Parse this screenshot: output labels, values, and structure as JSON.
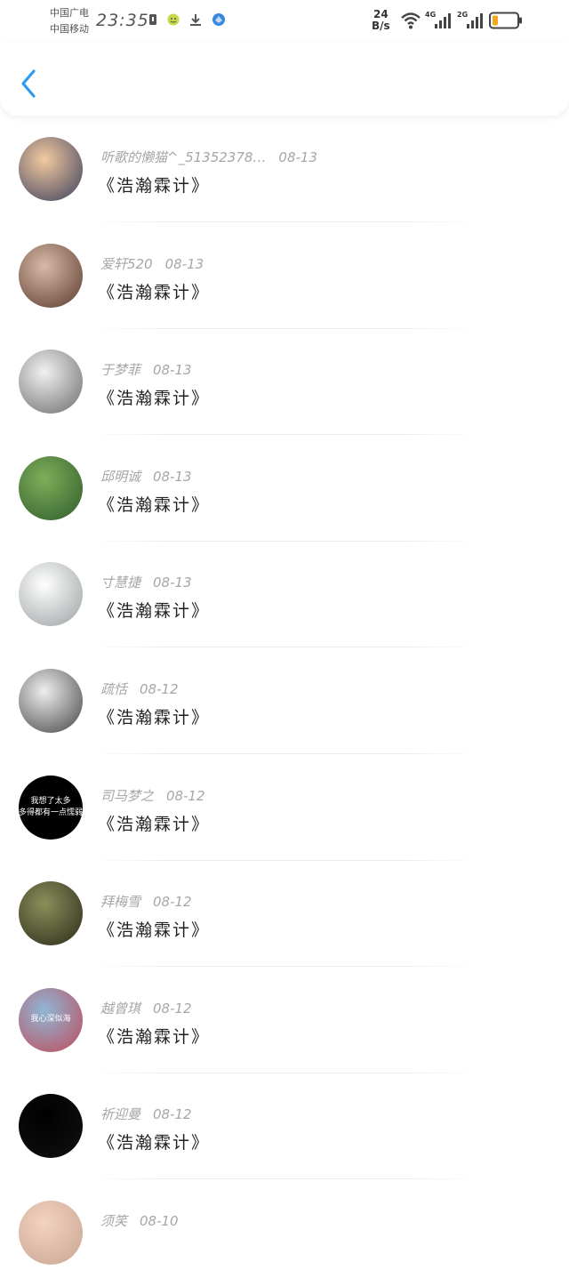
{
  "status_bar": {
    "carrier1": "中国广电",
    "carrier2": "中国移动",
    "time": "23:35",
    "net_speed_value": "24",
    "net_speed_unit": "B/s",
    "net1": "4G",
    "net2": "2G",
    "battery_color": "#f5a623"
  },
  "colors": {
    "accent": "#2a9af3",
    "meta_text": "#a6a6a6"
  },
  "list": [
    {
      "user": "听歌的懒猫^_51352378…",
      "date": "08-13",
      "title": "《浩瀚霖计》",
      "avatar_colors": [
        "#f3c9a0",
        "#3a3f5c"
      ]
    },
    {
      "user": "爱轩520",
      "date": "08-13",
      "title": "《浩瀚霖计》",
      "avatar_colors": [
        "#d9b9a8",
        "#5a3b2c"
      ]
    },
    {
      "user": "于梦菲",
      "date": "08-13",
      "title": "《浩瀚霖计》",
      "avatar_colors": [
        "#f1f1f1",
        "#6b6b6b"
      ]
    },
    {
      "user": "邱明诚",
      "date": "08-13",
      "title": "《浩瀚霖计》",
      "avatar_colors": [
        "#7fae5a",
        "#2f5c2a"
      ]
    },
    {
      "user": "寸慧捷",
      "date": "08-13",
      "title": "《浩瀚霖计》",
      "avatar_colors": [
        "#ffffff",
        "#9aa0a0"
      ]
    },
    {
      "user": "疏恬",
      "date": "08-12",
      "title": "《浩瀚霖计》",
      "avatar_colors": [
        "#eeeeee",
        "#444444"
      ]
    },
    {
      "user": "司马梦之",
      "date": "08-12",
      "title": "《浩瀚霖计》",
      "avatar_colors": [
        "#000000",
        "#000000"
      ],
      "avatar_text": "我想了太多\n多得都有一点懦弱"
    },
    {
      "user": "拜梅雪",
      "date": "08-12",
      "title": "《浩瀚霖计》",
      "avatar_colors": [
        "#8a8f5a",
        "#2c2a1a"
      ]
    },
    {
      "user": "越曾琪",
      "date": "08-12",
      "title": "《浩瀚霖计》",
      "avatar_colors": [
        "#8fb7d6",
        "#c04a5a"
      ],
      "avatar_text": "我心深似海"
    },
    {
      "user": "祈迎曼",
      "date": "08-12",
      "title": "《浩瀚霖计》",
      "avatar_colors": [
        "#000000",
        "#111111"
      ]
    },
    {
      "user": "须笑",
      "date": "08-10",
      "title": "",
      "avatar_colors": [
        "#f2d2c0",
        "#c9a591"
      ]
    }
  ]
}
